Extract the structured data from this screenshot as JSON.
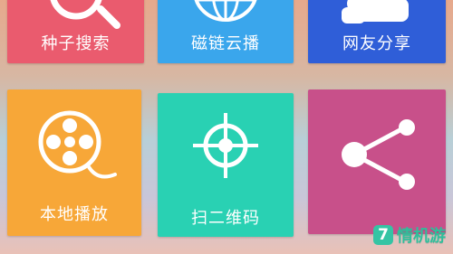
{
  "tiles": {
    "seed_search": {
      "label": "种子搜索",
      "icon": "magnifier-icon",
      "color": "#ea5b6e"
    },
    "magnet_cloud": {
      "label": "磁链云播",
      "icon": "globe-icon",
      "color": "#3aa6ec"
    },
    "netizen_share": {
      "label": "网友分享",
      "icon": "group-icon",
      "color": "#2f5ed8"
    },
    "local_play": {
      "label": "本地播放",
      "icon": "film-reel-icon",
      "color": "#f7a738"
    },
    "scan_qr": {
      "label": "扫二维码",
      "icon": "crosshair-icon",
      "color": "#29d1b3"
    },
    "share": {
      "label": "",
      "icon": "share-icon",
      "color": "#c8508a"
    }
  },
  "watermark": {
    "badge": "7",
    "text": "情机游"
  }
}
